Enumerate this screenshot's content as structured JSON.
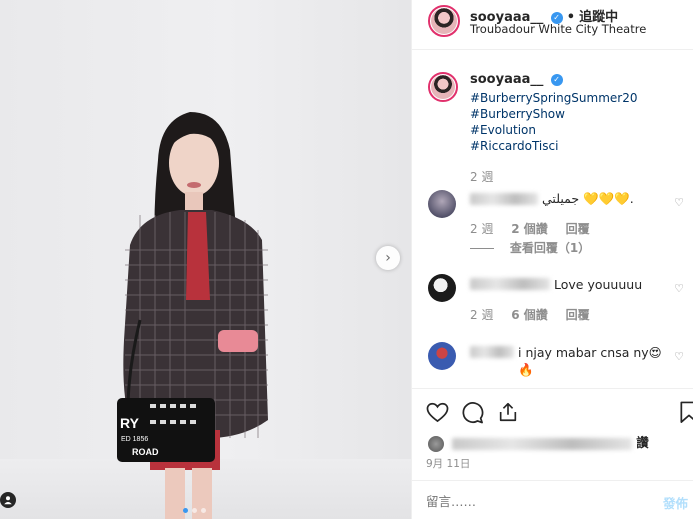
{
  "header": {
    "username": "sooyaaa__",
    "separator": "•",
    "follow_label": "追蹤中",
    "location": "Troubadour White City Theatre"
  },
  "caption": {
    "username": "sooyaaa__",
    "hashtags": [
      "#BurberrySpringSummer20",
      "#BurberryShow",
      "#Evolution",
      "#RiccardoTisci"
    ],
    "time": "2 週"
  },
  "comments": [
    {
      "text": "جميلتي 💛💛💛.",
      "time": "2 週",
      "likes": "2 個讚",
      "reply": "回覆"
    },
    {
      "text": "Love youuuuu",
      "time": "2 週",
      "likes": "6 個讚",
      "reply": "回覆"
    },
    {
      "text": "i njay mabar cnsa ny😍🔥"
    }
  ],
  "view_replies": "查看回覆（1）",
  "likes_suffix": "讚",
  "date": "9月 11日",
  "comment_placeholder": "留言……",
  "post_label": "發佈",
  "photo": {
    "bag_line1": "RY",
    "bag_line2": "ED 1856",
    "bag_line3": "ROAD"
  },
  "colors": {
    "link": "#003569",
    "verified": "#3897f0",
    "muted": "#8e8e8e"
  },
  "icons": [
    "heart-icon",
    "comment-icon",
    "share-icon",
    "bookmark-icon",
    "chevron-right-icon",
    "user-tag-icon",
    "verified-icon"
  ]
}
